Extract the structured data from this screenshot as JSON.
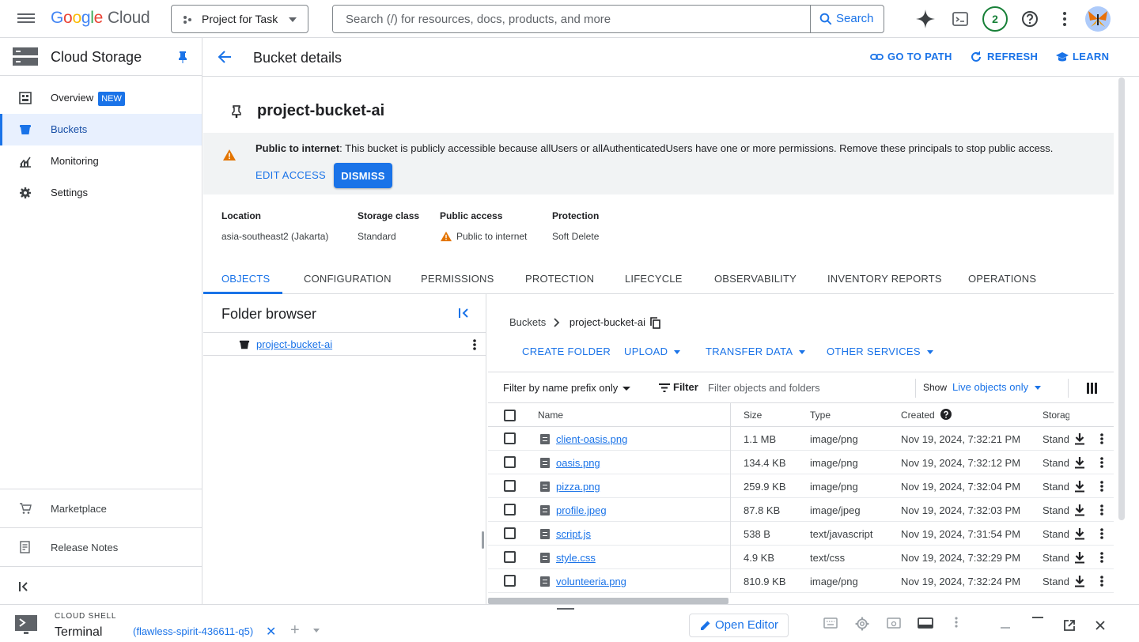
{
  "topbar": {
    "logo_google": "Google",
    "logo_cloud": "Cloud",
    "project": "Project for Task",
    "search_placeholder": "Search (/) for resources, docs, products, and more",
    "search_button": "Search",
    "notifications_count": "2"
  },
  "sidebar": {
    "title": "Cloud Storage",
    "items": [
      {
        "label": "Overview",
        "badge": "NEW",
        "icon": "overview-icon"
      },
      {
        "label": "Buckets",
        "icon": "bucket-icon",
        "active": true
      },
      {
        "label": "Monitoring",
        "icon": "monitoring-icon"
      },
      {
        "label": "Settings",
        "icon": "gear-icon"
      }
    ],
    "bottom": [
      {
        "label": "Marketplace",
        "icon": "cart-icon"
      },
      {
        "label": "Release Notes",
        "icon": "notes-icon"
      }
    ]
  },
  "header": {
    "title": "Bucket details",
    "go_to_path": "GO TO PATH",
    "refresh": "REFRESH",
    "learn": "LEARN"
  },
  "bucket": {
    "name": "project-bucket-ai",
    "banner_bold": "Public to internet",
    "banner_text": ": This bucket is publicly accessible because allUsers or allAuthenticatedUsers have one or more permissions. Remove these principals to stop public access.",
    "edit_access": "EDIT ACCESS",
    "dismiss": "DISMISS",
    "info": [
      {
        "key": "Location",
        "value": "asia-southeast2 (Jakarta)"
      },
      {
        "key": "Storage class",
        "value": "Standard"
      },
      {
        "key": "Public access",
        "value": "Public to internet"
      },
      {
        "key": "Protection",
        "value": "Soft Delete"
      }
    ]
  },
  "tabs": [
    "OBJECTS",
    "CONFIGURATION",
    "PERMISSIONS",
    "PROTECTION",
    "LIFECYCLE",
    "OBSERVABILITY",
    "INVENTORY REPORTS",
    "OPERATIONS"
  ],
  "folder_browser": {
    "title": "Folder browser",
    "root": "project-bucket-ai"
  },
  "objects": {
    "breadcrumb_root": "Buckets",
    "breadcrumb_current": "project-bucket-ai",
    "actions": {
      "create_folder": "CREATE FOLDER",
      "upload": "UPLOAD",
      "transfer_data": "TRANSFER DATA",
      "other_services": "OTHER SERVICES"
    },
    "filter_prefix": "Filter by name prefix only",
    "filter_label": "Filter",
    "filter_placeholder": "Filter objects and folders",
    "show_label": "Show",
    "show_value": "Live objects only",
    "columns": {
      "name": "Name",
      "size": "Size",
      "type": "Type",
      "created": "Created",
      "storage": "Storag"
    },
    "rows": [
      {
        "name": "client-oasis.png",
        "size": "1.1 MB",
        "type": "image/png",
        "created": "Nov 19, 2024, 7:32:21 PM",
        "storage": "Stand"
      },
      {
        "name": "oasis.png",
        "size": "134.4 KB",
        "type": "image/png",
        "created": "Nov 19, 2024, 7:32:12 PM",
        "storage": "Stand"
      },
      {
        "name": "pizza.png",
        "size": "259.9 KB",
        "type": "image/png",
        "created": "Nov 19, 2024, 7:32:04 PM",
        "storage": "Stand"
      },
      {
        "name": "profile.jpeg",
        "size": "87.8 KB",
        "type": "image/jpeg",
        "created": "Nov 19, 2024, 7:32:03 PM",
        "storage": "Stand"
      },
      {
        "name": "script.js",
        "size": "538 B",
        "type": "text/javascript",
        "created": "Nov 19, 2024, 7:31:54 PM",
        "storage": "Stand"
      },
      {
        "name": "style.css",
        "size": "4.9 KB",
        "type": "text/css",
        "created": "Nov 19, 2024, 7:32:29 PM",
        "storage": "Stand"
      },
      {
        "name": "volunteeria.png",
        "size": "810.9 KB",
        "type": "image/png",
        "created": "Nov 19, 2024, 7:32:24 PM",
        "storage": "Stand"
      }
    ]
  },
  "cloud_shell": {
    "label": "CLOUD SHELL",
    "terminal": "Terminal",
    "tab": "(flawless-spirit-436611-q5)",
    "open_editor": "Open Editor"
  },
  "colors": {
    "accent": "#1a73e8",
    "warning": "#e37400",
    "active_bg": "#e8f0fe"
  }
}
